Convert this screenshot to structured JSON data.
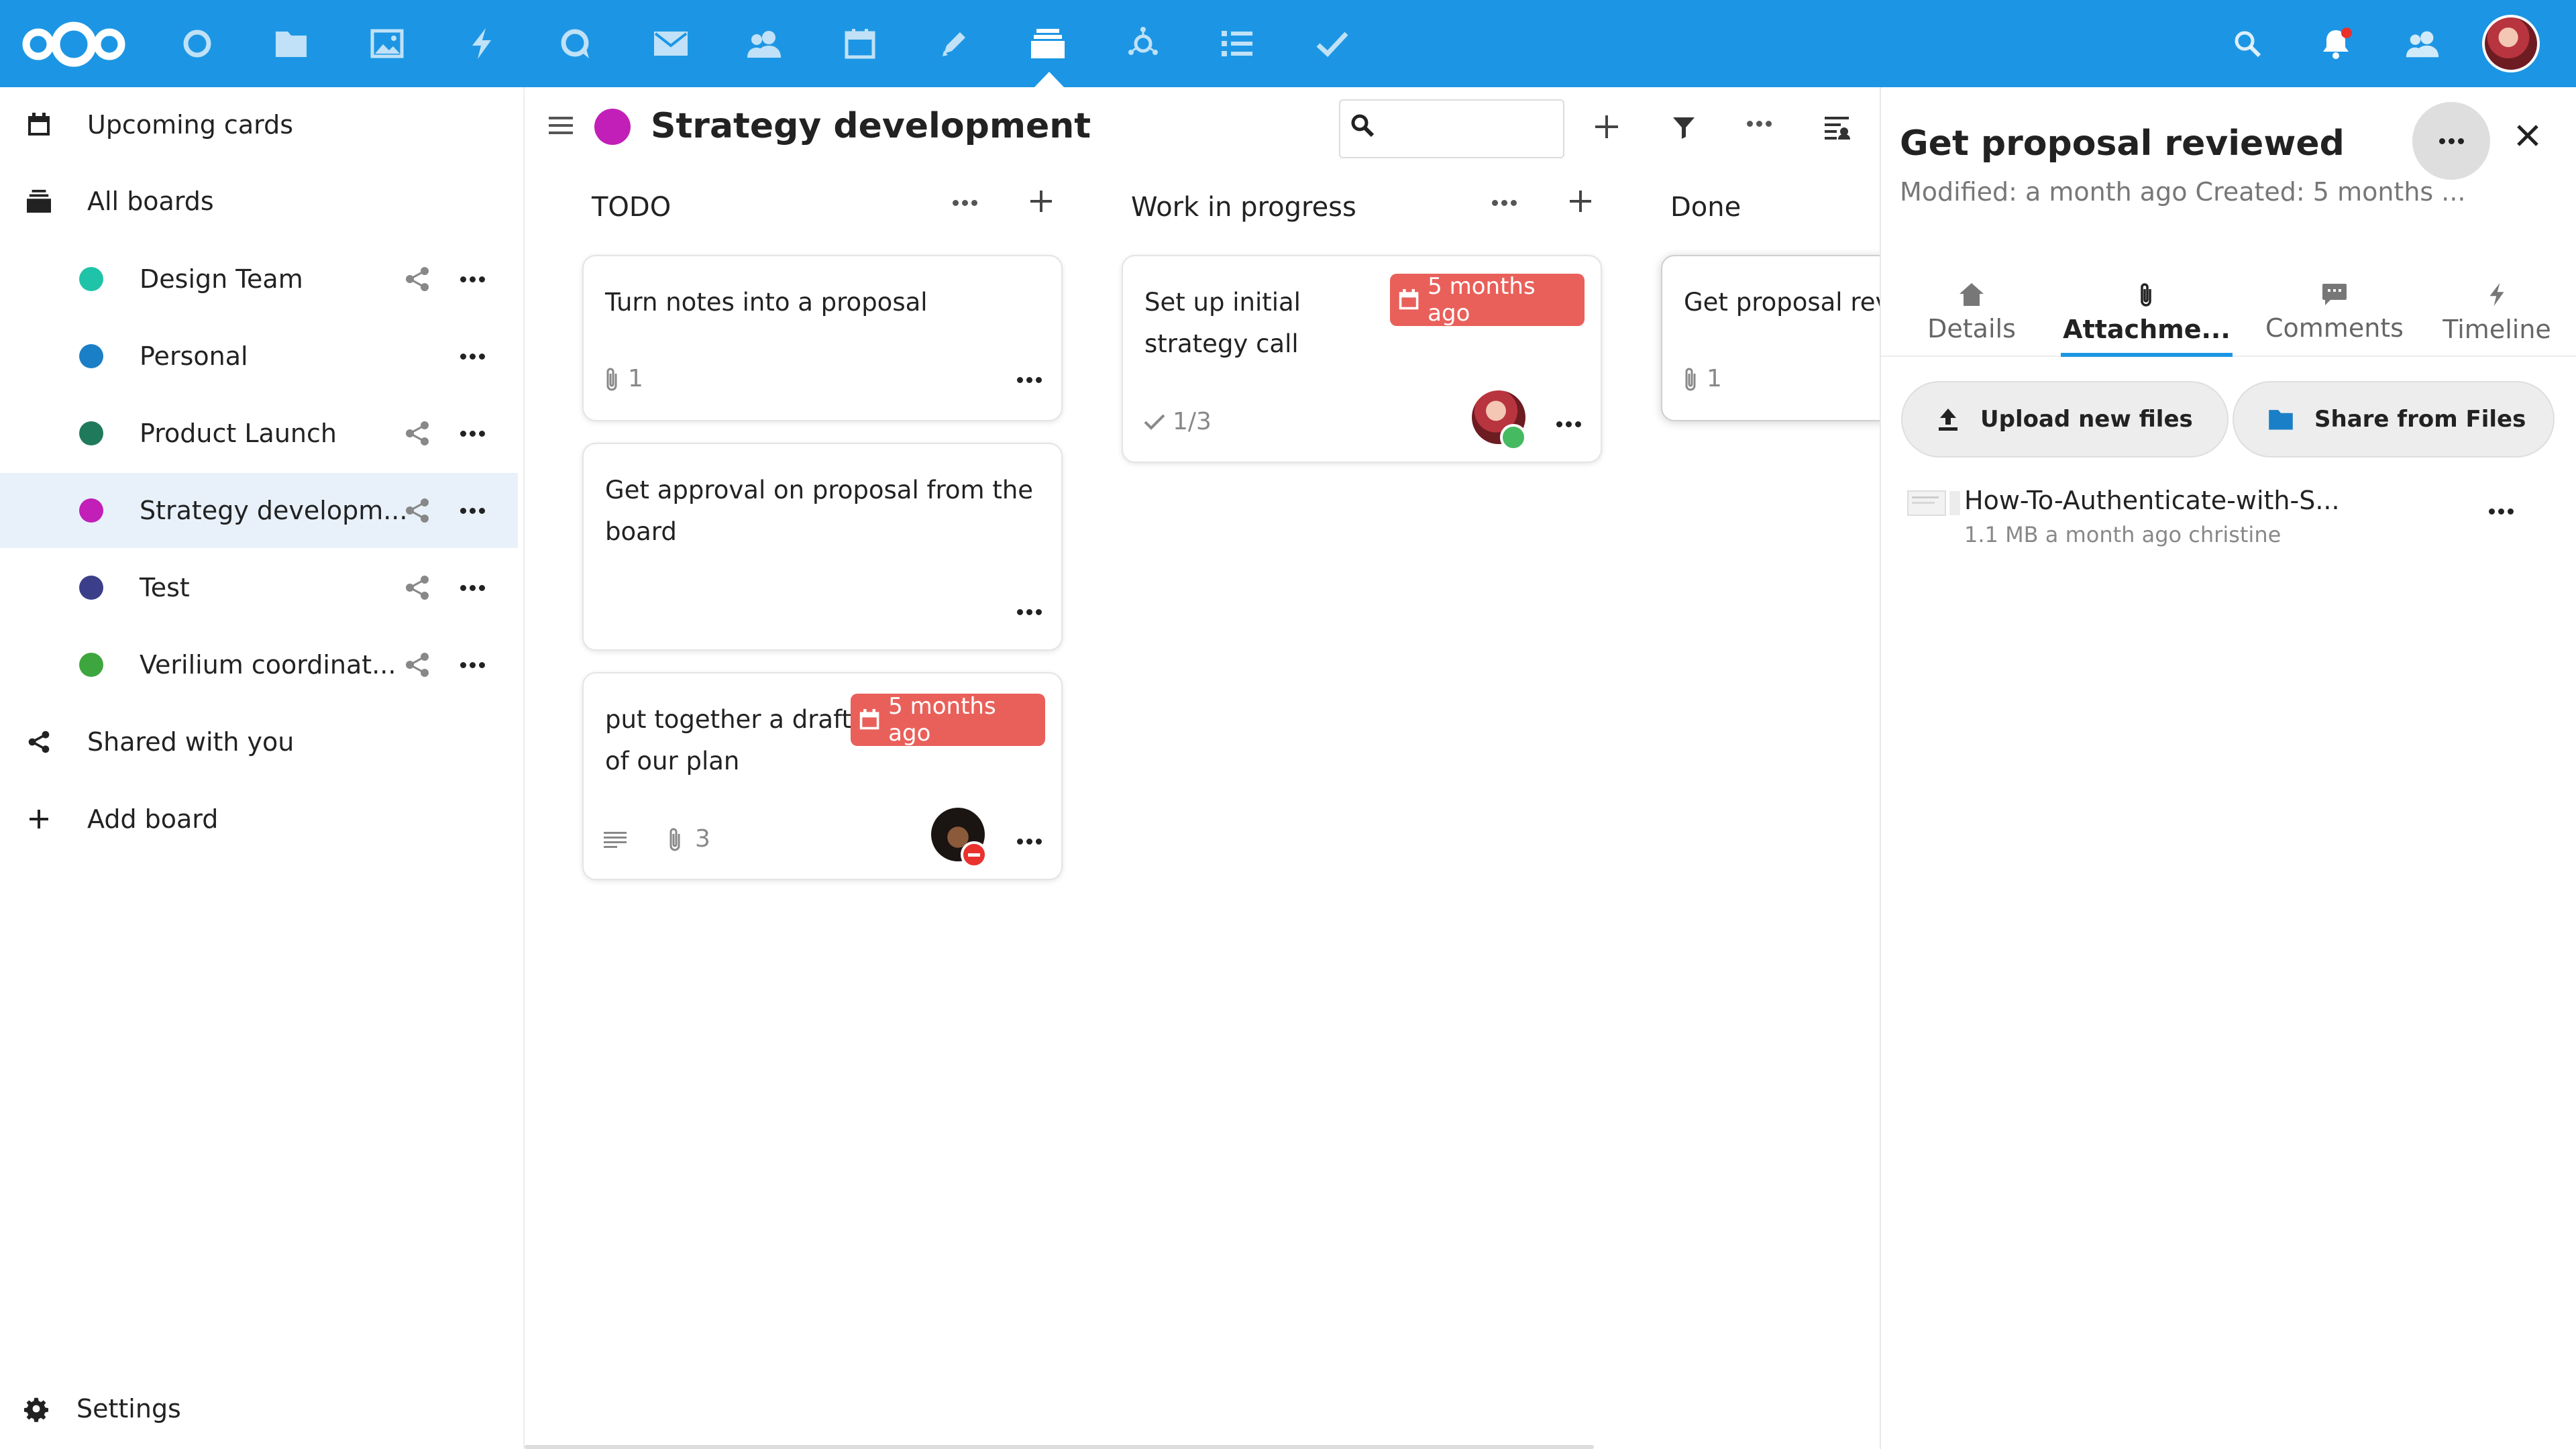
{
  "header": {
    "apps": [
      {
        "name": "dashboard-icon"
      },
      {
        "name": "files-icon"
      },
      {
        "name": "photos-icon"
      },
      {
        "name": "activity-icon"
      },
      {
        "name": "talk-icon"
      },
      {
        "name": "mail-icon"
      },
      {
        "name": "contacts-icon"
      },
      {
        "name": "calendar-icon"
      },
      {
        "name": "notes-icon"
      },
      {
        "name": "deck-icon",
        "active": true
      },
      {
        "name": "circles-icon"
      },
      {
        "name": "tasks-icon"
      },
      {
        "name": "checkmark-icon"
      }
    ],
    "accent": "#1c96e4"
  },
  "nav": {
    "upcoming": "Upcoming cards",
    "all_boards": "All boards",
    "boards": [
      {
        "label": "Design Team",
        "color": "#1fc4a8",
        "shared": true
      },
      {
        "label": "Personal",
        "color": "#1a7fc6",
        "shared": false
      },
      {
        "label": "Product Launch",
        "color": "#1f7a5c",
        "shared": true
      },
      {
        "label": "Strategy developm...",
        "color": "#c21fb8",
        "shared": true,
        "active": true
      },
      {
        "label": "Test",
        "color": "#3b3f8a",
        "shared": true
      },
      {
        "label": "Verilium coordinat...",
        "color": "#3ea63e",
        "shared": true
      }
    ],
    "shared_with_you": "Shared with you",
    "add_board": "Add board",
    "settings": "Settings"
  },
  "board": {
    "title": "Strategy development",
    "color": "#c21fb8",
    "stacks": [
      {
        "title": "TODO"
      },
      {
        "title": "Work in progress"
      },
      {
        "title": "Done"
      }
    ],
    "cards": {
      "c1": {
        "title": "Turn notes into a proposal",
        "attachments": "1"
      },
      "c2": {
        "title": "Get approval on proposal from the board"
      },
      "c3": {
        "title": "put together a draft of our plan",
        "due": "5 months ago",
        "attachments": "3"
      },
      "c4": {
        "title": "Set up initial strategy call",
        "due": "5 months ago",
        "checklist": "1/3"
      },
      "c5": {
        "title": "Get proposal revi",
        "attachments": "1"
      }
    }
  },
  "sidebar": {
    "title": "Get proposal reviewed",
    "subtitle": "Modified: a month ago Created: 5 months ...",
    "tabs": [
      "Details",
      "Attachme...",
      "Comments",
      "Timeline"
    ],
    "active_tab": "Attachme...",
    "upload_button": "Upload new files",
    "share_button": "Share from Files",
    "attachment": {
      "name": "How-To-Authenticate-with-S...",
      "meta": "1.1 MB a month ago christine"
    }
  }
}
